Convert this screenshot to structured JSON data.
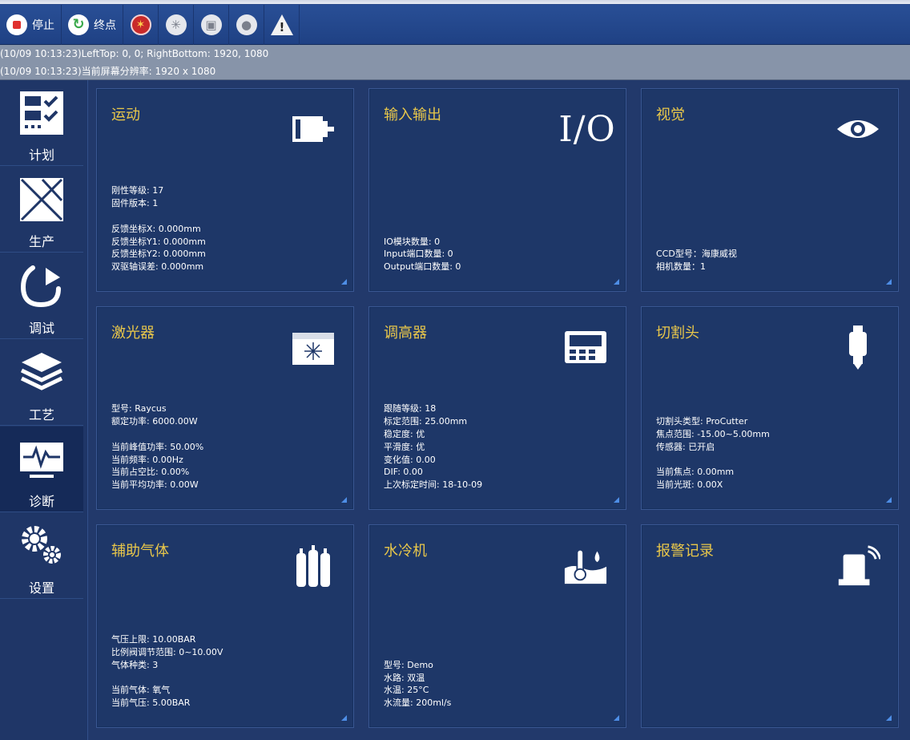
{
  "toolbar": {
    "stop_label": "停止",
    "end_label": "终点"
  },
  "log": {
    "line1": "(10/09 10:13:23)LeftTop: 0, 0; RightBottom: 1920, 1080",
    "line2": "(10/09 10:13:23)当前屏幕分辨率: 1920 x 1080"
  },
  "sidebar": {
    "items": [
      {
        "label": "计划",
        "icon": "plan-checklist-icon"
      },
      {
        "label": "生产",
        "icon": "production-sheet-icon"
      },
      {
        "label": "调试",
        "icon": "debug-arrow-icon"
      },
      {
        "label": "工艺",
        "icon": "process-layers-icon"
      },
      {
        "label": "诊断",
        "icon": "diagnosis-monitor-icon"
      },
      {
        "label": "设置",
        "icon": "settings-gears-icon"
      }
    ],
    "active_index": 4
  },
  "cards": {
    "motion": {
      "title": "运动",
      "lines": [
        "刚性等级: 17",
        "固件版本: 1",
        "",
        "反馈坐标X: 0.000mm",
        "反馈坐标Y1: 0.000mm",
        "反馈坐标Y2: 0.000mm",
        "双驱轴误差: 0.000mm"
      ]
    },
    "io": {
      "title": "输入输出",
      "icon_text": "I/O",
      "lines": [
        "IO模块数量: 0",
        "Input端口数量: 0",
        "Output端口数量: 0"
      ]
    },
    "vision": {
      "title": "视觉",
      "lines": [
        "CCD型号：海康威视",
        "相机数量：1"
      ]
    },
    "laser": {
      "title": "激光器",
      "lines": [
        "型号: Raycus",
        "额定功率: 6000.00W",
        "",
        "当前峰值功率: 50.00%",
        "当前频率: 0.00Hz",
        "当前占空比: 0.00%",
        "当前平均功率: 0.00W"
      ]
    },
    "height": {
      "title": "调高器",
      "lines": [
        "跟随等级: 18",
        "标定范围: 25.00mm",
        "稳定度: 优",
        "平滑度: 优",
        "变化值: 0.00",
        "DIF: 0.00",
        "上次标定时间: 18-10-09"
      ]
    },
    "head": {
      "title": "切割头",
      "lines": [
        "切割头类型: ProCutter",
        "焦点范围: -15.00~5.00mm",
        "传感器: 已开启",
        "",
        "当前焦点: 0.00mm",
        "当前光斑: 0.00X"
      ]
    },
    "gas": {
      "title": "辅助气体",
      "lines": [
        "气压上限: 10.00BAR",
        "比例阀调节范围: 0~10.00V",
        "气体种类: 3",
        "",
        "当前气体: 氧气",
        "当前气压: 5.00BAR"
      ]
    },
    "chiller": {
      "title": "水冷机",
      "lines": [
        "型号: Demo",
        "水路: 双温",
        "水温: 25°C",
        "水流量: 200ml/s"
      ]
    },
    "alarm": {
      "title": "报警记录",
      "lines": []
    }
  },
  "colors": {
    "card_title": "#e9c74a",
    "card_bg": "#1e3768",
    "accent_corner": "#4e8ee6"
  }
}
